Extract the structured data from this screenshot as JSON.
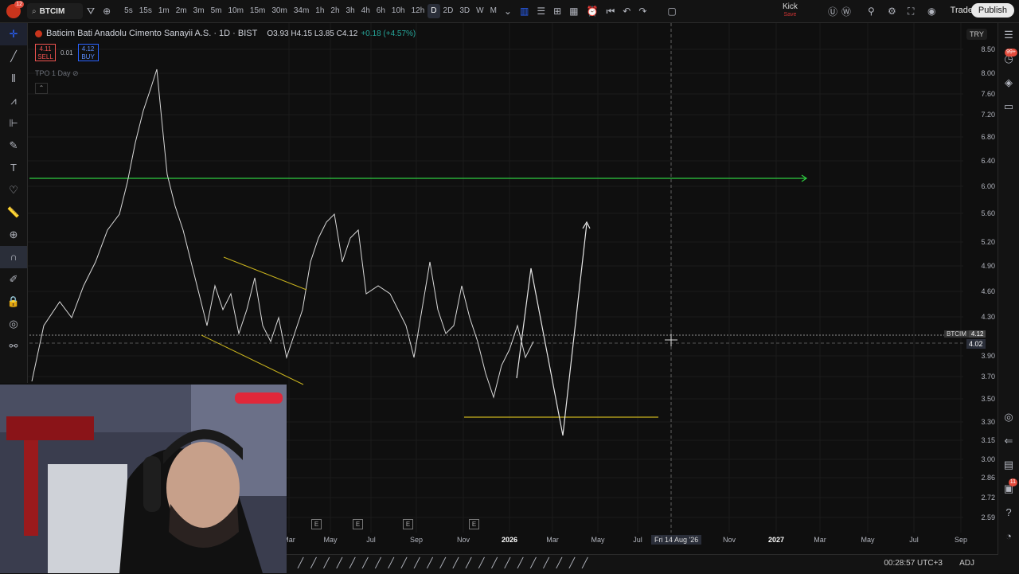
{
  "toolbar": {
    "logo_badge": "12",
    "symbol": "BTCIM",
    "intervals": [
      "5s",
      "15s",
      "1m",
      "2m",
      "3m",
      "5m",
      "10m",
      "15m",
      "30m",
      "34m",
      "1h",
      "2h",
      "3h",
      "4h",
      "6h",
      "10h",
      "12h",
      "D",
      "2D",
      "3D",
      "W",
      "M"
    ],
    "active_interval": "D",
    "kick_label": "Kick",
    "kick_sub": "Save",
    "trade_label": "Trade",
    "publish_label": "Publish"
  },
  "legend": {
    "title": "Baticim Bati Anadolu Cimento Sanayii A.S. · 1D · BIST",
    "ohlc": "O3.93 H4.15 L3.85 C4.12",
    "change": "+0.18 (+4.57%)",
    "sell_price": "4.11",
    "sell_label": "SELL",
    "spread": "0.01",
    "buy_price": "4.12",
    "buy_label": "BUY",
    "indicator": "TPO 1 Day"
  },
  "currency": "TRY",
  "price_labels": [
    "8.50",
    "8.00",
    "7.60",
    "7.20",
    "6.80",
    "6.40",
    "6.00",
    "5.60",
    "5.20",
    "4.90",
    "4.60",
    "4.30",
    "3.90",
    "3.70",
    "3.50",
    "3.30",
    "3.15",
    "3.00",
    "2.86",
    "2.72",
    "2.59"
  ],
  "price_tag": {
    "symbol": "BTCIM",
    "value": "4.12"
  },
  "crosshair_price": "4.02",
  "crosshair_time": "Fri 14 Aug '26",
  "time_labels": [
    {
      "text": "Mar",
      "bold": false
    },
    {
      "text": "May",
      "bold": false
    },
    {
      "text": "Jul",
      "bold": false
    },
    {
      "text": "Sep",
      "bold": false
    },
    {
      "text": "Nov",
      "bold": false
    },
    {
      "text": "2026",
      "bold": true
    },
    {
      "text": "Mar",
      "bold": false
    },
    {
      "text": "May",
      "bold": false
    },
    {
      "text": "Jul",
      "bold": false
    },
    {
      "text": "Nov",
      "bold": false
    },
    {
      "text": "2027",
      "bold": true
    },
    {
      "text": "Mar",
      "bold": false
    },
    {
      "text": "May",
      "bold": false
    },
    {
      "text": "Jul",
      "bold": false
    },
    {
      "text": "Sep",
      "bold": false
    }
  ],
  "earnings_marker": "E",
  "right_badge": "99+",
  "right_badge2": "11",
  "clock": "00:28:57 UTC+3",
  "adj_label": "ADJ"
}
